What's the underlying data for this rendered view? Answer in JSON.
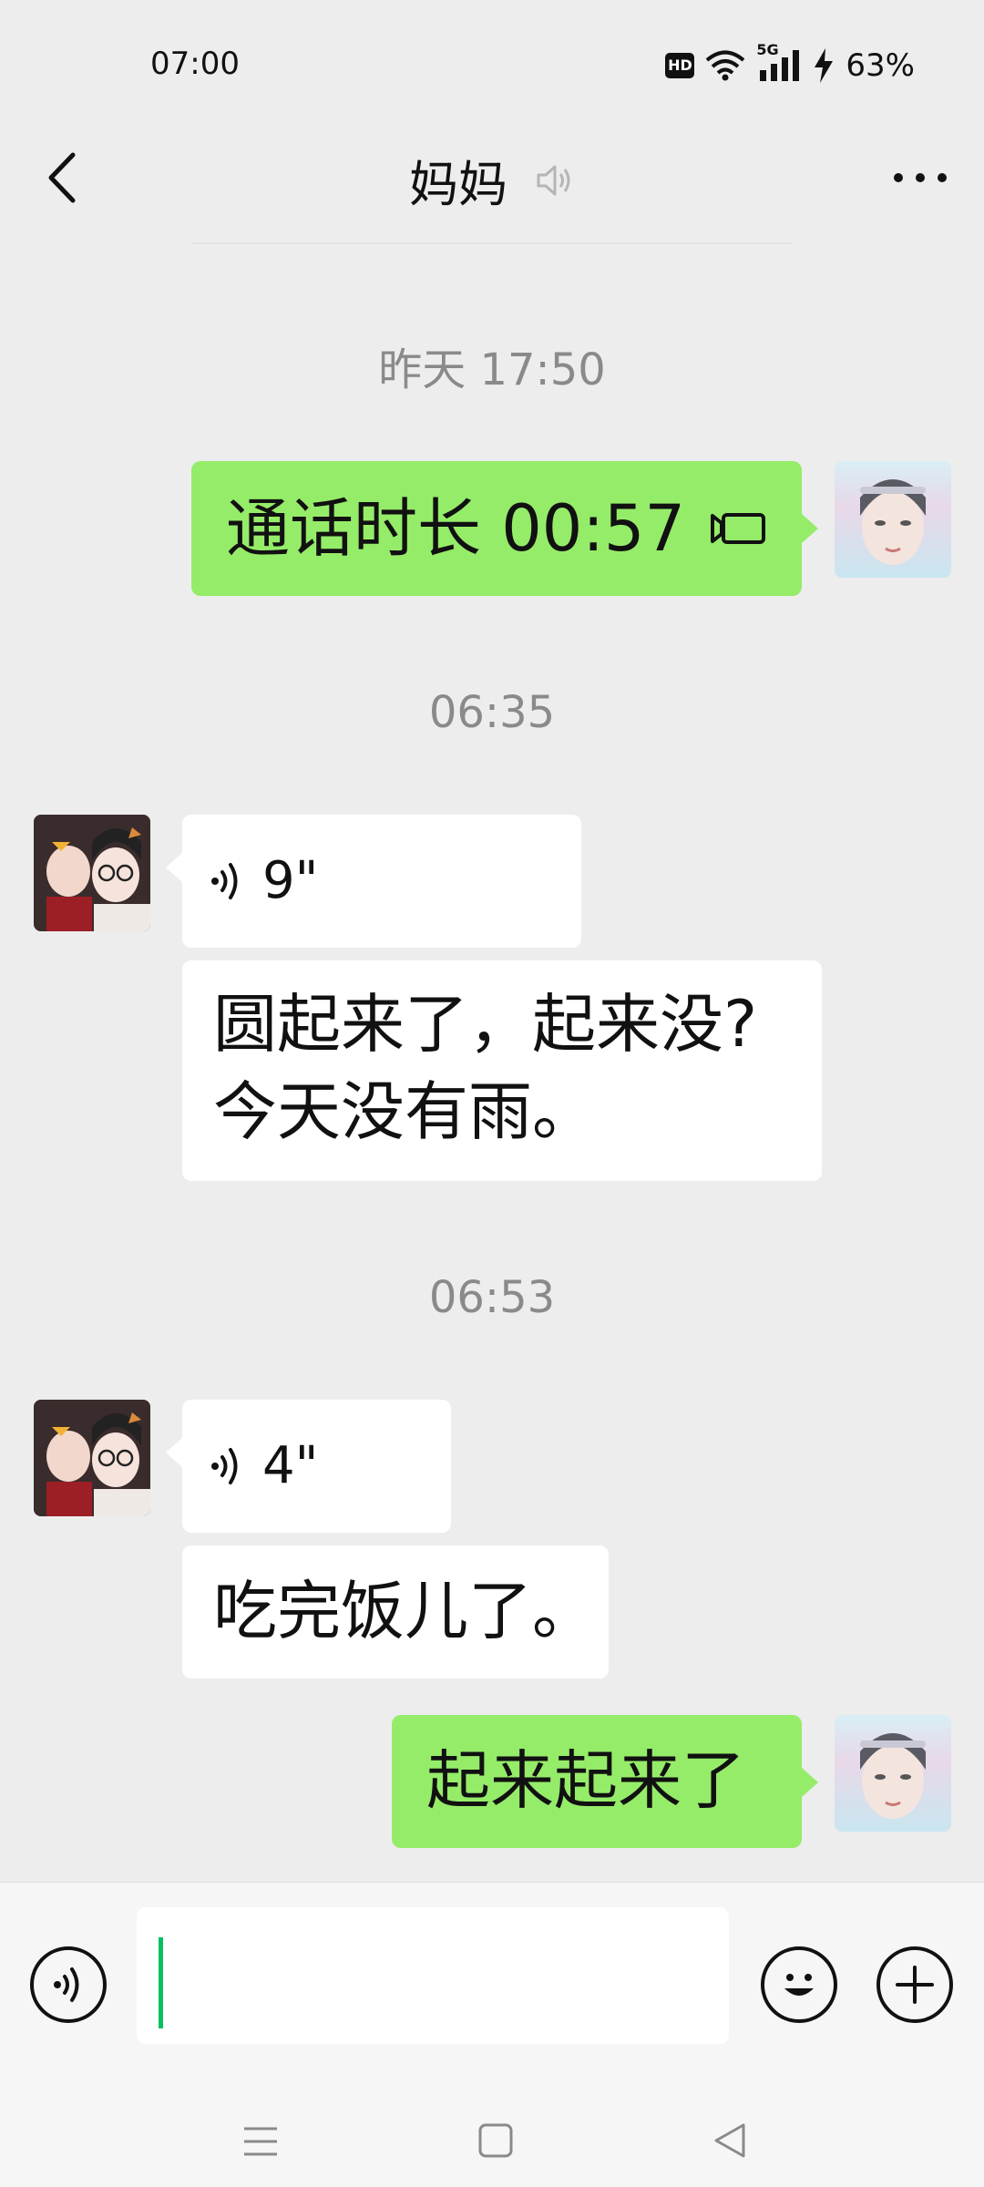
{
  "status_bar": {
    "time": "07:00",
    "hd": "HD",
    "network": "5G",
    "battery": "63%"
  },
  "header": {
    "title": "妈妈",
    "back_icon": "chevron-left-icon",
    "muted_icon": "speaker-muted-icon",
    "more_icon": "more-dots-icon"
  },
  "messages": {
    "stamp1": "昨天 17:50",
    "call_text": "通话时长 00:57",
    "stamp2": "06:35",
    "voice1": "9\"",
    "text1_line1": "圆起来了，起来没?",
    "text1_line2": "今天没有雨。",
    "stamp3": "06:53",
    "voice2": "4\"",
    "text2": "吃完饭儿了。",
    "reply": "起来起来了"
  },
  "input": {
    "value": "",
    "voice_icon": "voice-input-icon",
    "emoji_icon": "emoji-icon",
    "plus_icon": "plus-icon"
  },
  "colors": {
    "self_bubble": "#95ec69",
    "other_bubble": "#ffffff",
    "background": "#ededed",
    "caret": "#07c160"
  }
}
